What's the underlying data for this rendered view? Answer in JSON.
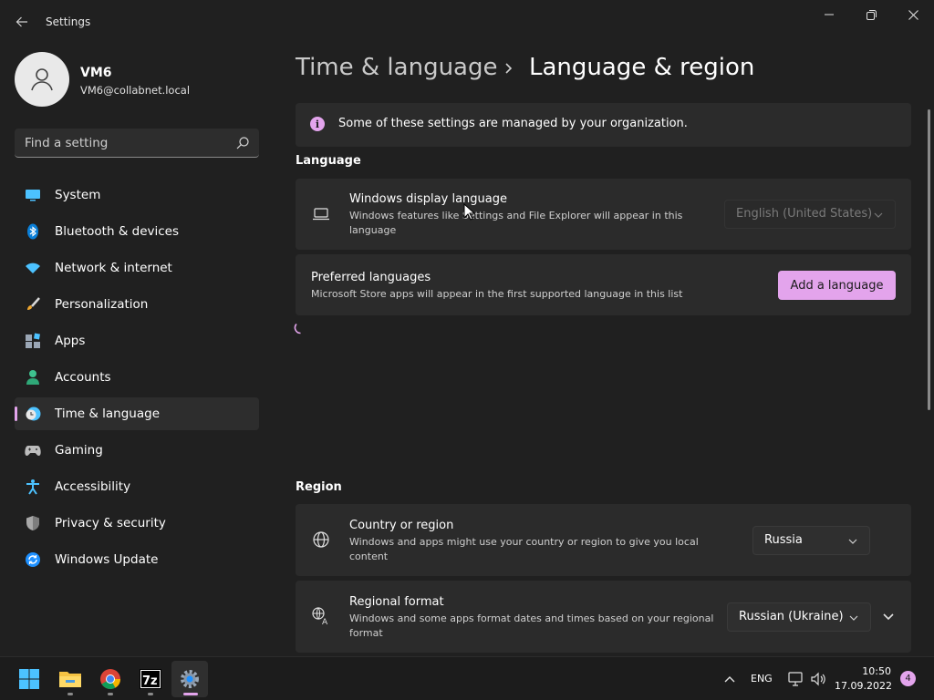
{
  "window": {
    "title": "Settings",
    "icons": {
      "back": "back-arrow-icon",
      "minimize": "minimize-icon",
      "maximize": "restore-icon",
      "close": "close-icon"
    }
  },
  "profile": {
    "name": "VM6",
    "email": "VM6@collabnet.local",
    "avatar_icon": "person-icon"
  },
  "search": {
    "placeholder": "Find a setting",
    "value": "",
    "icon": "search-icon"
  },
  "nav": {
    "selected": "Time & language",
    "accent": "#e3a4ec",
    "items": [
      {
        "label": "System",
        "icon": "monitor-icon"
      },
      {
        "label": "Bluetooth & devices",
        "icon": "bluetooth-icon"
      },
      {
        "label": "Network & internet",
        "icon": "wifi-icon"
      },
      {
        "label": "Personalization",
        "icon": "brush-icon"
      },
      {
        "label": "Apps",
        "icon": "apps-icon"
      },
      {
        "label": "Accounts",
        "icon": "accounts-icon"
      },
      {
        "label": "Time & language",
        "icon": "clock-globe-icon"
      },
      {
        "label": "Gaming",
        "icon": "gamepad-icon"
      },
      {
        "label": "Accessibility",
        "icon": "accessibility-icon"
      },
      {
        "label": "Privacy & security",
        "icon": "shield-icon"
      },
      {
        "label": "Windows Update",
        "icon": "update-icon"
      }
    ]
  },
  "main": {
    "breadcrumb_parent": "Time & language",
    "title": "Language & region",
    "org_notice": "Some of these settings are managed by your organization.",
    "language_section": {
      "header": "Language",
      "display_language": {
        "title": "Windows display language",
        "description": "Windows features like Settings and File Explorer will appear in this language",
        "value": "English (United States)",
        "icon": "laptop-icon"
      },
      "preferred_languages": {
        "title": "Preferred languages",
        "description": "Microsoft Store apps will appear in the first supported language in this list",
        "button": "Add a language"
      }
    },
    "region_section": {
      "header": "Region",
      "country": {
        "title": "Country or region",
        "description": "Windows and apps might use your country or region to give you local content",
        "value": "Russia",
        "icon": "globe-icon"
      },
      "regional_format": {
        "title": "Regional format",
        "description": "Windows and some apps format dates and times based on your regional format",
        "value": "Russian (Ukraine)",
        "icon": "regional-format-icon"
      }
    }
  },
  "taskbar": {
    "apps": [
      {
        "name": "Start",
        "icon": "windows-start-icon"
      },
      {
        "name": "File Explorer",
        "icon": "folder-icon"
      },
      {
        "name": "Google Chrome",
        "icon": "chrome-icon"
      },
      {
        "name": "7-Zip",
        "icon": "7zip-icon"
      },
      {
        "name": "Settings",
        "icon": "settings-gear-icon"
      }
    ],
    "tray": {
      "language": "ENG",
      "time": "10:50",
      "date": "17.09.2022",
      "notifications": "4"
    }
  }
}
